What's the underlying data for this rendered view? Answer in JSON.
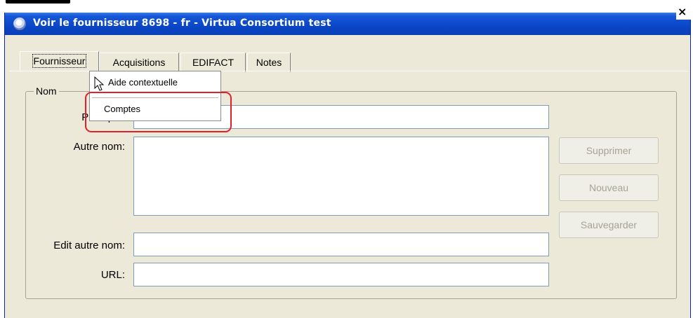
{
  "window": {
    "title": "Voir le fournisseur 8698 - fr - Virtua Consortium test",
    "close_glyph": "×"
  },
  "tabs": [
    {
      "label": "Fournisseur",
      "active": true
    },
    {
      "label": "Acquisitions",
      "active": false
    },
    {
      "label": "EDIFACT",
      "active": false
    },
    {
      "label": "Notes",
      "active": false
    }
  ],
  "context_menu": {
    "items": [
      "Aide contextuelle",
      "Comptes"
    ]
  },
  "form": {
    "group_label": "Nom",
    "principal_label": "Principal:",
    "autre_nom_label": "Autre nom:",
    "edit_autre_nom_label": "Edit autre nom:",
    "url_label": "URL:",
    "principal_value": "",
    "autre_nom_value": "",
    "edit_autre_nom_value": "",
    "url_value": ""
  },
  "buttons": {
    "supprimer": "Supprimer",
    "nouveau": "Nouveau",
    "sauvegarder": "Sauvegarder"
  },
  "colors": {
    "titlebar": "#0a46c8",
    "window_bg": "#ece9d8",
    "highlight": "#e0202a"
  }
}
